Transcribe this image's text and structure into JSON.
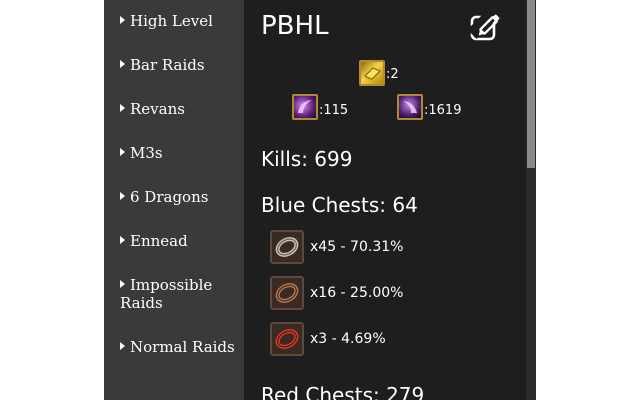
{
  "sidebar": {
    "items": [
      {
        "label": "High Level"
      },
      {
        "label": "Bar Raids"
      },
      {
        "label": "Revans"
      },
      {
        "label": "M3s"
      },
      {
        "label": "6 Dragons"
      },
      {
        "label": "Ennead"
      },
      {
        "label": "Impossible Raids"
      },
      {
        "label": "Normal Raids"
      }
    ]
  },
  "main": {
    "title": "PBHL",
    "edit_icon": "edit-icon",
    "items": [
      {
        "icon": "gold-brick-icon",
        "count": ":2"
      },
      {
        "icon": "purple-horn-icon-a",
        "count": ":115"
      },
      {
        "icon": "purple-horn-icon-b",
        "count": ":1619"
      }
    ],
    "kills": "Kills: 699",
    "blue_chests": {
      "heading": "Blue Chests: 64",
      "drops": [
        {
          "icon": "silver-ring-icon",
          "text": "x45 - 70.31%"
        },
        {
          "icon": "bronze-ring-icon",
          "text": "x16 - 25.00%"
        },
        {
          "icon": "red-ring-icon",
          "text": "x3 - 4.69%"
        }
      ]
    },
    "red_chests": {
      "heading": "Red Chests: 279"
    }
  },
  "colors": {
    "sidebar_bg": "#3a3a3a",
    "main_bg": "#1e1e1e",
    "text": "#ffffff",
    "scrollbar_thumb": "#8a8a8a"
  }
}
